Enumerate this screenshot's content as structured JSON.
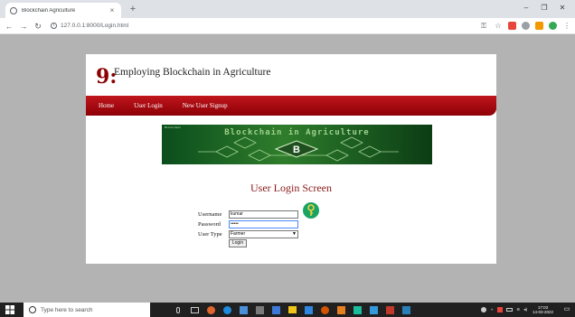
{
  "browser": {
    "tab_title": "Blockchain Agriculture",
    "tab_close": "×",
    "new_tab": "+",
    "url": "127.0.0.1:8000/Login.html",
    "window_minimize": "–",
    "window_restore": "❐",
    "window_close": "✕"
  },
  "site": {
    "logo_mark": "9:",
    "title": "Employing Blockchain in Agriculture",
    "nav": [
      "Home",
      "User Login",
      "New User Signup"
    ],
    "banner_title": "Blockchain in Agriculture",
    "banner_small": "Blockchain"
  },
  "login": {
    "heading": "User Login Screen",
    "username_label": "Username",
    "username_value": "kumar",
    "password_label": "Password",
    "password_value": "•••••",
    "usertype_label": "User Type",
    "usertype_value": "Farmer",
    "submit_label": "Login"
  },
  "taskbar": {
    "search_placeholder": "Type here to search",
    "time": "17:03",
    "date": "14-03-2022"
  },
  "colors": {
    "nav_bar": "#b0101a",
    "heading": "#8b1a1a",
    "banner": "#2f7d2c",
    "key_badge": "#19a463"
  }
}
